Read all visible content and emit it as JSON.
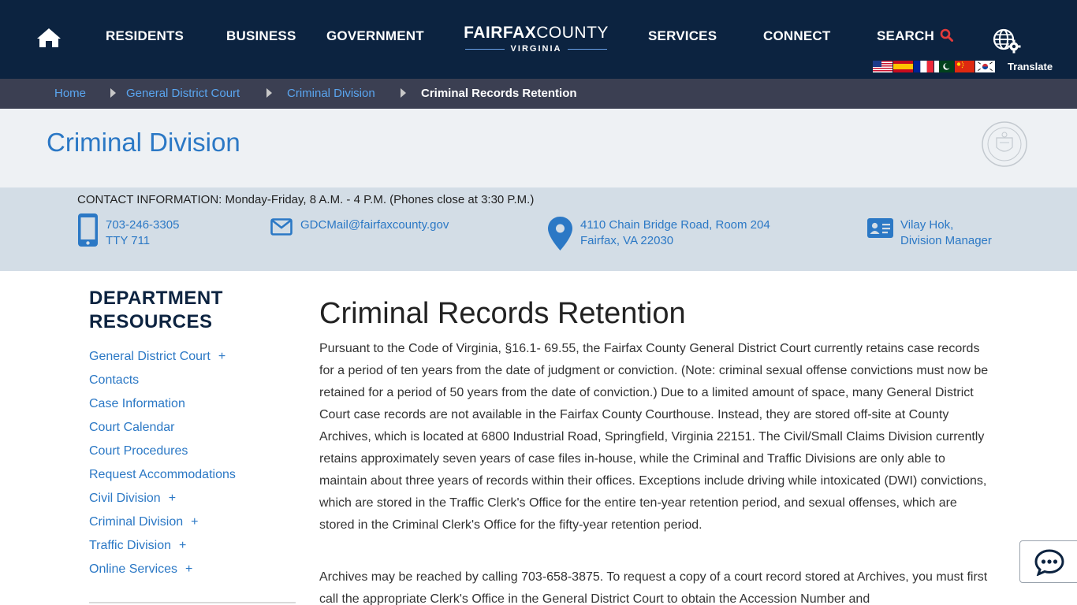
{
  "nav": {
    "items": [
      "RESIDENTS",
      "BUSINESS",
      "GOVERNMENT",
      "SERVICES",
      "CONNECT"
    ],
    "search_label": "SEARCH",
    "logo_bold": "FAIRFAX",
    "logo_light": "COUNTY",
    "logo_sub": "VIRGINIA",
    "translate_label": "Translate"
  },
  "breadcrumb": {
    "items": [
      "Home",
      "General District Court",
      "Criminal Division"
    ],
    "current": "Criminal Records Retention"
  },
  "banner": {
    "title": "Criminal Division"
  },
  "contact": {
    "heading": "CONTACT INFORMATION: Monday-Friday, 8 A.M. - 4 P.M. (Phones close at 3:30 P.M.)",
    "phone": "703-246-3305",
    "tty": "TTY 711",
    "email": "GDCMail@fairfaxcounty.gov",
    "address_line1": "4110 Chain Bridge Road, Room 204",
    "address_line2": "Fairfax, VA 22030",
    "manager_name": "Vilay Hok,",
    "manager_title": "Division Manager"
  },
  "sidebar": {
    "title": "DEPARTMENT RESOURCES",
    "items": [
      {
        "label": "General District Court",
        "expand": "+"
      },
      {
        "label": "Contacts",
        "expand": ""
      },
      {
        "label": "Case Information",
        "expand": ""
      },
      {
        "label": "Court Calendar",
        "expand": ""
      },
      {
        "label": "Court Procedures",
        "expand": ""
      },
      {
        "label": "Request Accommodations",
        "expand": ""
      },
      {
        "label": "Civil Division",
        "expand": "+"
      },
      {
        "label": "Criminal Division",
        "expand": "+"
      },
      {
        "label": "Traffic Division",
        "expand": "+"
      },
      {
        "label": "Online Services",
        "expand": "+"
      }
    ]
  },
  "main": {
    "title": "Criminal Records Retention",
    "paragraph1": "Pursuant to the Code of Virginia, §16.1- 69.55, the Fairfax County General District Court currently retains case records for a period of ten years from the date of judgment or conviction. (Note: criminal sexual offense convictions must now be retained for a period of 50 years from the date of conviction.) Due to a limited amount of space, many General District Court case records are not available in the Fairfax County Courthouse. Instead, they are stored off-site at County Archives, which is located at 6800 Industrial Road, Springfield, Virginia 22151. The Civil/Small Claims Division currently retains approximately seven years of case files in-house, while the Criminal and Traffic Divisions are only able to maintain about three years of records within their offices. Exceptions include driving while intoxicated (DWI) convictions, which are stored in the Traffic Clerk's Office for the entire ten-year retention period, and sexual offenses, which are stored in the Criminal Clerk's Office for the fifty-year retention period.",
    "paragraph2": "Archives may be reached by calling 703-658-3875. To request a copy of a court record stored at Archives, you must first call the appropriate Clerk's Office in the General District Court to obtain the Accession Number and"
  },
  "colors": {
    "nav_bg": "#0c2340",
    "breadcrumb_bg": "#3b3f52",
    "link": "#2b78c5",
    "banner_bg": "#eef1f4",
    "contact_bg": "#d3dde6"
  },
  "icons": {
    "home": "home-icon",
    "search": "search-icon",
    "globe": "globe-gear-icon",
    "phone": "mobile-phone-icon",
    "email": "envelope-icon",
    "location": "map-pin-icon",
    "contact_card": "id-card-icon",
    "chat": "chat-bubble-icon"
  }
}
